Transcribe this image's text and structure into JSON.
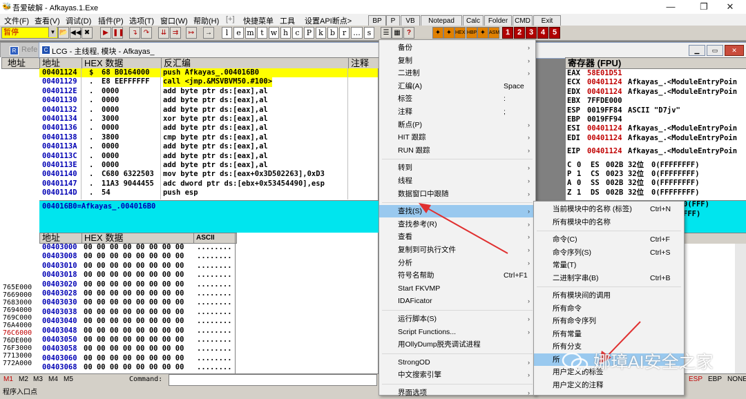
{
  "window": {
    "title": "吾爱破解 - Afkayas.1.Exe",
    "minimize": "—",
    "maximize": "❐",
    "close": "✕"
  },
  "menubar": [
    "文件(F)",
    "查看(V)",
    "调试(D)",
    "插件(P)",
    "选项(T)",
    "窗口(W)",
    "帮助(H)",
    "[+]",
    "快捷菜单",
    "工具",
    "设置API断点>"
  ],
  "quick_buttons": [
    "BP",
    "P",
    "VB",
    "Notepad",
    "Calc",
    "Folder",
    "CMD",
    "Exit"
  ],
  "toolbar": {
    "status": "暂停",
    "letters": [
      "l",
      "e",
      "m",
      "t",
      "w",
      "h",
      "c",
      "P",
      "k",
      "b",
      "r",
      "...",
      "s"
    ],
    "numbers": [
      "1",
      "2",
      "3",
      "4",
      "5"
    ]
  },
  "cpu": {
    "title": "LCG - 主线程, 模块 - Afkayas_",
    "behind_title": "Refe",
    "headers": {
      "addr": "地址",
      "hex": "HEX 数据",
      "disasm": "反汇编",
      "comment": "注释"
    },
    "rows": [
      {
        "addr": "00401124",
        "mark": "$",
        "hex": "68 B0164000",
        "asm": "push Afkayas_.004016B0"
      },
      {
        "addr": "00401129",
        "mark": ".",
        "hex": "E8 EEFFFFFF",
        "asm": "call <jmp.&MSVBVM50.#100>"
      },
      {
        "addr": "0040112E",
        "mark": ".",
        "hex": "0000",
        "asm": "add byte ptr ds:[eax],al"
      },
      {
        "addr": "00401130",
        "mark": ".",
        "hex": "0000",
        "asm": "add byte ptr ds:[eax],al"
      },
      {
        "addr": "00401132",
        "mark": ".",
        "hex": "0000",
        "asm": "add byte ptr ds:[eax],al"
      },
      {
        "addr": "00401134",
        "mark": ".",
        "hex": "3000",
        "asm": "xor byte ptr ds:[eax],al"
      },
      {
        "addr": "00401136",
        "mark": ".",
        "hex": "0000",
        "asm": "add byte ptr ds:[eax],al"
      },
      {
        "addr": "00401138",
        "mark": ".",
        "hex": "3800",
        "asm": "cmp byte ptr ds:[eax],al"
      },
      {
        "addr": "0040113A",
        "mark": ".",
        "hex": "0000",
        "asm": "add byte ptr ds:[eax],al"
      },
      {
        "addr": "0040113C",
        "mark": ".",
        "hex": "0000",
        "asm": "add byte ptr ds:[eax],al"
      },
      {
        "addr": "0040113E",
        "mark": ".",
        "hex": "0000",
        "asm": "add byte ptr ds:[eax],al"
      },
      {
        "addr": "00401140",
        "mark": ".",
        "hex": "C680 6322503",
        "asm": "mov byte ptr ds:[eax+0x3D502263],0xD3"
      },
      {
        "addr": "00401147",
        "mark": ".",
        "hex": "11A3 9044455",
        "asm": "adc dword ptr ds:[ebx+0x53454490],esp"
      },
      {
        "addr": "0040114D",
        "mark": ".",
        "hex": "54",
        "asm": "push esp"
      }
    ],
    "info": "004016B0=Afkayas_.004016B0"
  },
  "dump": {
    "headers": {
      "addr": "地址",
      "hex": "HEX 数据",
      "ascii": "ASCII"
    },
    "rows": [
      {
        "addr": "00403000",
        "hex": "00 00 00 00 00 00 00 00",
        "ascii": "........"
      },
      {
        "addr": "00403008",
        "hex": "00 00 00 00 00 00 00 00",
        "ascii": "........"
      },
      {
        "addr": "00403010",
        "hex": "00 00 00 00 00 00 00 00",
        "ascii": "........"
      },
      {
        "addr": "00403018",
        "hex": "00 00 00 00 00 00 00 00",
        "ascii": "........"
      },
      {
        "addr": "00403020",
        "hex": "00 00 00 00 00 00 00 00",
        "ascii": "........"
      },
      {
        "addr": "00403028",
        "hex": "00 00 00 00 00 00 00 00",
        "ascii": "........"
      },
      {
        "addr": "00403030",
        "hex": "00 00 00 00 00 00 00 00",
        "ascii": "........"
      },
      {
        "addr": "00403038",
        "hex": "00 00 00 00 00 00 00 00",
        "ascii": "........"
      },
      {
        "addr": "00403040",
        "hex": "00 00 00 00 00 00 00 00",
        "ascii": "........"
      },
      {
        "addr": "00403048",
        "hex": "00 00 00 00 00 00 00 00",
        "ascii": "........"
      },
      {
        "addr": "00403050",
        "hex": "00 00 00 00 00 00 00 00",
        "ascii": "........"
      },
      {
        "addr": "00403058",
        "hex": "00 00 00 00 00 00 00 00",
        "ascii": "........"
      },
      {
        "addr": "00403060",
        "hex": "00 00 00 00 00 00 00 00",
        "ascii": "........"
      },
      {
        "addr": "00403068",
        "hex": "00 00 00 00 00 00 00 00",
        "ascii": "........"
      }
    ]
  },
  "left_stub": {
    "header": "地址",
    "addrs": [
      "765E000",
      "7669000",
      "7683000",
      "7694000",
      "769C000",
      "76A4000",
      "76C6000",
      "76DE000",
      "76F3000",
      "7713000",
      "772A000"
    ]
  },
  "registers": {
    "title": "寄存器 (FPU)",
    "regs": [
      {
        "n": "EAX",
        "v": "58E01D51",
        "c": ""
      },
      {
        "n": "ECX",
        "v": "00401124",
        "c": "Afkayas_.<ModuleEntryPoin"
      },
      {
        "n": "EDX",
        "v": "00401124",
        "c": "Afkayas_.<ModuleEntryPoin"
      },
      {
        "n": "EBX",
        "v": "7FFDE000",
        "c": ""
      },
      {
        "n": "ESP",
        "v": "0019FF84",
        "c": "ASCII \"D7jv\""
      },
      {
        "n": "EBP",
        "v": "0019FF94",
        "c": ""
      },
      {
        "n": "ESI",
        "v": "00401124",
        "c": "Afkayas_.<ModuleEntryPoin"
      },
      {
        "n": "EDI",
        "v": "00401124",
        "c": "Afkayas_.<ModuleEntryPoin"
      },
      {
        "n": "EIP",
        "v": "00401124",
        "c": "Afkayas_.<ModuleEntryPoin"
      }
    ],
    "flags": [
      {
        "f": "C",
        "b": "0",
        "s": "ES",
        "v": "002B",
        "w": "32位",
        "x": "0(FFFFFFFF)"
      },
      {
        "f": "P",
        "b": "1",
        "s": "CS",
        "v": "0023",
        "w": "32位",
        "x": "0(FFFFFFFF)"
      },
      {
        "f": "A",
        "b": "0",
        "s": "SS",
        "v": "002B",
        "w": "32位",
        "x": "0(FFFFFFFF)"
      },
      {
        "f": "Z",
        "b": "1",
        "s": "DS",
        "v": "002B",
        "w": "32位",
        "x": "0(FFFFFFFF)"
      }
    ],
    "tail1": "0(FFF)",
    "tail2": "FFF)"
  },
  "stack_tabs": [
    "ESP",
    "EBP",
    "NONE"
  ],
  "bottom": {
    "mtabs": [
      "M1",
      "M2",
      "M3",
      "M4",
      "M5"
    ],
    "command_label": "Command:",
    "status": "程序入口点"
  },
  "context_menu": [
    {
      "label": "备份",
      "arrow": "›"
    },
    {
      "label": "复制",
      "arrow": "›"
    },
    {
      "label": "二进制",
      "arrow": "›"
    },
    {
      "label": "汇编(A)",
      "shortcut": "Space"
    },
    {
      "label": "标签",
      "shortcut": ":"
    },
    {
      "label": "注释",
      "shortcut": ";"
    },
    {
      "label": "断点(P)",
      "arrow": "›"
    },
    {
      "label": "HIT 跟踪",
      "arrow": "›"
    },
    {
      "label": "RUN 跟踪",
      "arrow": "›"
    },
    {
      "sep": true
    },
    {
      "label": "转到",
      "arrow": "›"
    },
    {
      "label": "线程",
      "arrow": "›"
    },
    {
      "label": "数据窗口中跟随",
      "arrow": "›"
    },
    {
      "sep": true
    },
    {
      "label": "查找(S)",
      "arrow": "›",
      "hl": true
    },
    {
      "label": "查找参考(R)",
      "arrow": "›"
    },
    {
      "label": "查看",
      "arrow": "›"
    },
    {
      "label": "复制到可执行文件",
      "arrow": "›"
    },
    {
      "label": "分析",
      "arrow": "›"
    },
    {
      "label": "符号名帮助",
      "shortcut": "Ctrl+F1"
    },
    {
      "label": "Start FKVMP"
    },
    {
      "label": "IDAFicator",
      "arrow": "›"
    },
    {
      "sep": true
    },
    {
      "label": "运行脚本(S)",
      "arrow": "›"
    },
    {
      "label": "Script Functions...",
      "arrow": "›"
    },
    {
      "label": "用OllyDump脱壳调试进程"
    },
    {
      "sep": true
    },
    {
      "label": "StrongOD",
      "arrow": "›"
    },
    {
      "label": "中文搜索引擎",
      "arrow": "›"
    },
    {
      "sep": true
    },
    {
      "label": "界面选项",
      "arrow": "›"
    }
  ],
  "submenu": [
    {
      "label": "当前模块中的名称 (标签)",
      "shortcut": "Ctrl+N"
    },
    {
      "label": "所有模块中的名称"
    },
    {
      "sep": true
    },
    {
      "label": "命令(C)",
      "shortcut": "Ctrl+F"
    },
    {
      "label": "命令序列(S)",
      "shortcut": "Ctrl+S"
    },
    {
      "label": "常量(T)"
    },
    {
      "label": "二进制字串(B)",
      "shortcut": "Ctrl+B"
    },
    {
      "sep": true
    },
    {
      "label": "所有模块间的调用"
    },
    {
      "label": "所有命令"
    },
    {
      "label": "所有命令序列"
    },
    {
      "label": "所有常量"
    },
    {
      "label": "所有分支"
    },
    {
      "label": "所",
      "hl": true
    },
    {
      "label": "用户定义的标签"
    },
    {
      "label": "用户定义的注释"
    }
  ],
  "watermark": "娜璋AI安全之家",
  "colors": {
    "highlight_yellow": "#ffff00",
    "info_cyan": "#00e5ee",
    "addr_blue": "#0000b4",
    "eip_red": "#c00000",
    "menu_hl": "#99c9ef",
    "arrow_red": "#e03030"
  }
}
